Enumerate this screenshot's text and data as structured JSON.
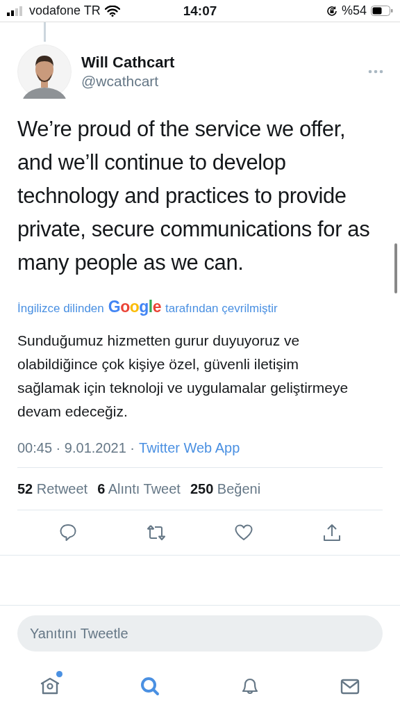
{
  "status_bar": {
    "carrier": "vodafone TR",
    "time": "14:07",
    "battery": "%54"
  },
  "tweet": {
    "author": {
      "name": "Will Cathcart",
      "handle": "@wcathcart"
    },
    "text": "We’re proud of the service we offer, and we’ll continue to develop technology and practices to provide private, secure communications for as many people as we can.",
    "translation": {
      "before": "İngilizce dilinden",
      "logo": "Google",
      "after": "tarafından çevrilmiştir",
      "text": "Sunduğumuz hizmetten gurur duyuyoruz ve olabildiğince çok kişiye özel, güvenli iletişim sağlamak için teknoloji ve uygulamalar geliştirmeye devam edeceğiz."
    },
    "time": "00:45 · 9.01.2021 ·",
    "source": "Twitter Web App",
    "stats": [
      {
        "count": "52",
        "label": "Retweet"
      },
      {
        "count": "6",
        "label": "Alıntı Tweet"
      },
      {
        "count": "250",
        "label": "Beğeni"
      }
    ],
    "actions": [
      {
        "kind": "reply"
      },
      {
        "kind": "retweet"
      },
      {
        "kind": "like"
      },
      {
        "kind": "share"
      }
    ]
  },
  "reply": {
    "placeholder": "Yanıtını Tweetle"
  },
  "tab_bar": [
    {
      "kind": "home",
      "selected": false,
      "badge": true
    },
    {
      "kind": "search",
      "selected": true,
      "badge": false
    },
    {
      "kind": "notifications",
      "selected": false,
      "badge": false
    },
    {
      "kind": "messages",
      "selected": false,
      "badge": false
    }
  ]
}
